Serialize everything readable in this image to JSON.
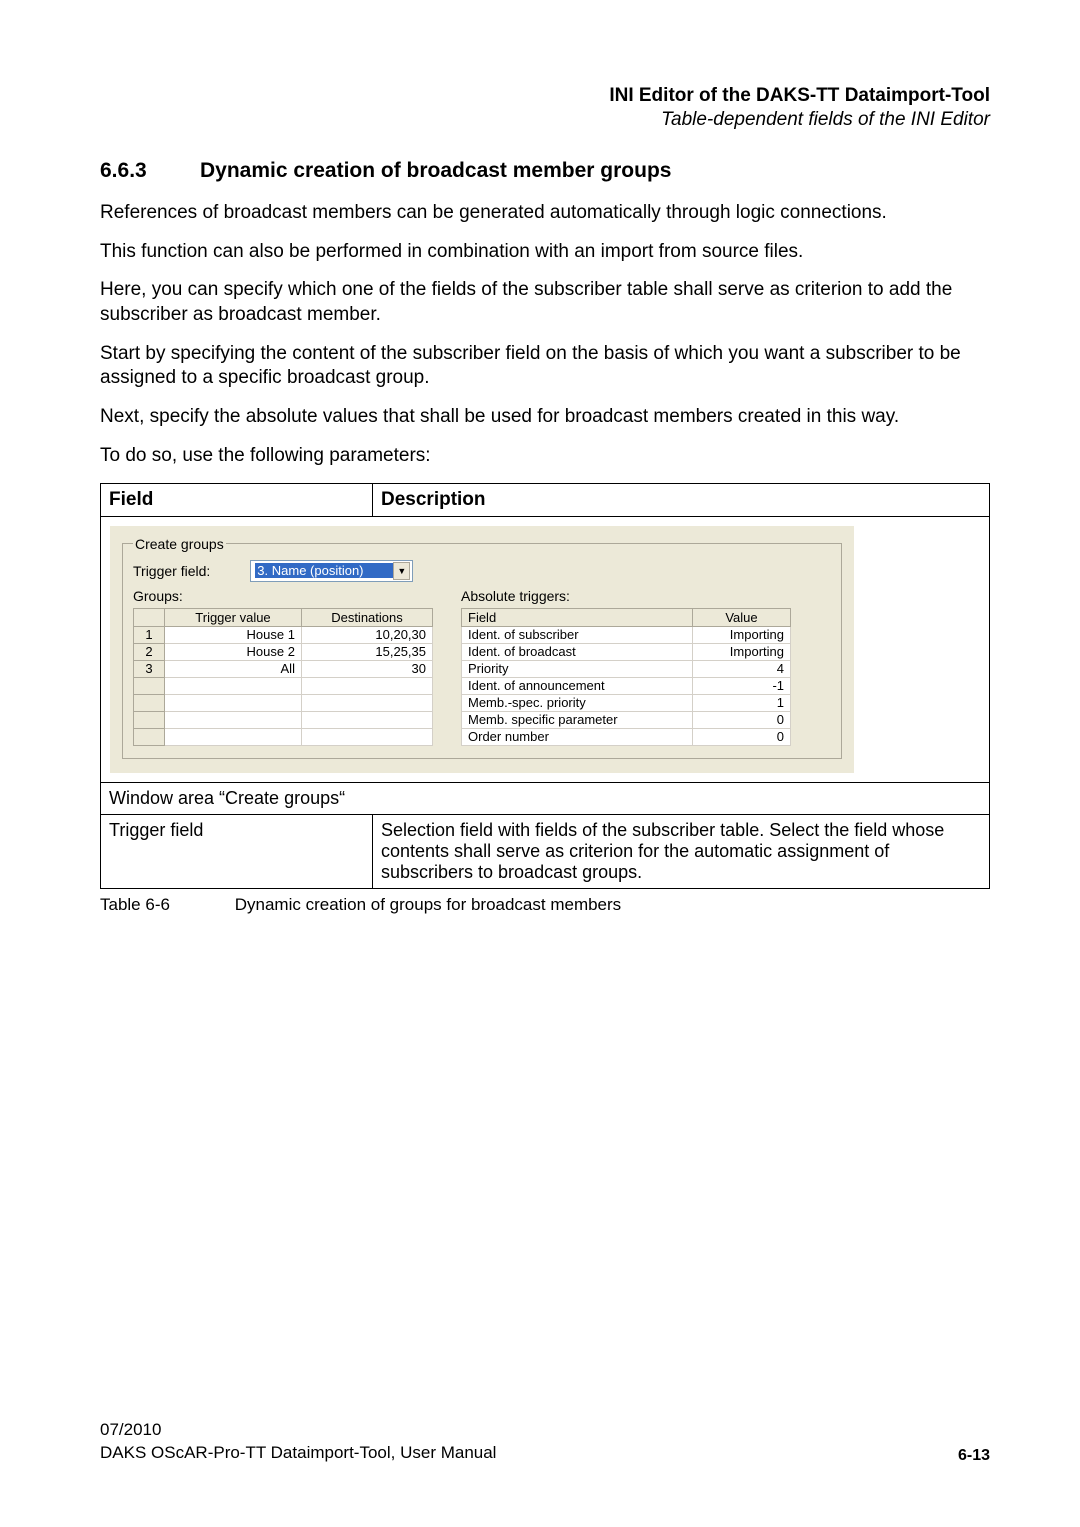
{
  "header": {
    "title": "INI Editor of the DAKS-TT Dataimport-Tool",
    "subtitle": "Table-dependent fields of the INI Editor"
  },
  "section": {
    "number": "6.6.3",
    "title": "Dynamic creation of broadcast member groups"
  },
  "paragraphs": {
    "p1": "References of broadcast members can be generated automatically through logic connections.",
    "p2": "This function can also be performed in combination with an import from source files.",
    "p3": "Here, you can specify which one of the fields of the subscriber table shall serve as criterion to add the subscriber as broadcast member.",
    "p4": "Start by specifying the content of the subscriber field on the basis of which you want a subscriber to be assigned to a specific broadcast group.",
    "p5": "Next, specify the absolute values that shall be used for broadcast members created in this way.",
    "p6": "To do so, use the following parameters:"
  },
  "table": {
    "headers": {
      "field": "Field",
      "desc": "Description"
    },
    "row_window": "Window area “Create groups“",
    "row_trigger_field": "Trigger field",
    "row_trigger_desc": "Selection field with fields of the subscriber table. Select the field whose contents shall serve as criterion for the automatic assignment of subscribers to broadcast groups."
  },
  "ui": {
    "group_label": "Create groups",
    "trigger_field_label": "Trigger field:",
    "trigger_field_value": "3. Name (position)",
    "groups_label": "Groups:",
    "absolute_label": "Absolute triggers:",
    "groups_headers": {
      "tv": "Trigger value",
      "dest": "Destinations"
    },
    "groups_rows": [
      {
        "n": "1",
        "tv": "House 1",
        "dest": "10,20,30"
      },
      {
        "n": "2",
        "tv": "House 2",
        "dest": "15,25,35"
      },
      {
        "n": "3",
        "tv": "All",
        "dest": "30"
      }
    ],
    "abs_headers": {
      "field": "Field",
      "value": "Value"
    },
    "abs_rows": [
      {
        "f": "Ident. of subscriber",
        "v": "Importing"
      },
      {
        "f": "Ident. of broadcast",
        "v": "Importing"
      },
      {
        "f": "Priority",
        "v": "4"
      },
      {
        "f": "Ident. of announcement",
        "v": "-1"
      },
      {
        "f": "Memb.-spec. priority",
        "v": "1"
      },
      {
        "f": "Memb. specific parameter",
        "v": "0"
      },
      {
        "f": "Order number",
        "v": "0"
      }
    ]
  },
  "caption": {
    "label": "Table 6-6",
    "text": "Dynamic creation of groups for broadcast members"
  },
  "footer": {
    "date": "07/2010",
    "doc": "DAKS OScAR-Pro-TT Dataimport-Tool, User Manual",
    "page": "6-13"
  }
}
